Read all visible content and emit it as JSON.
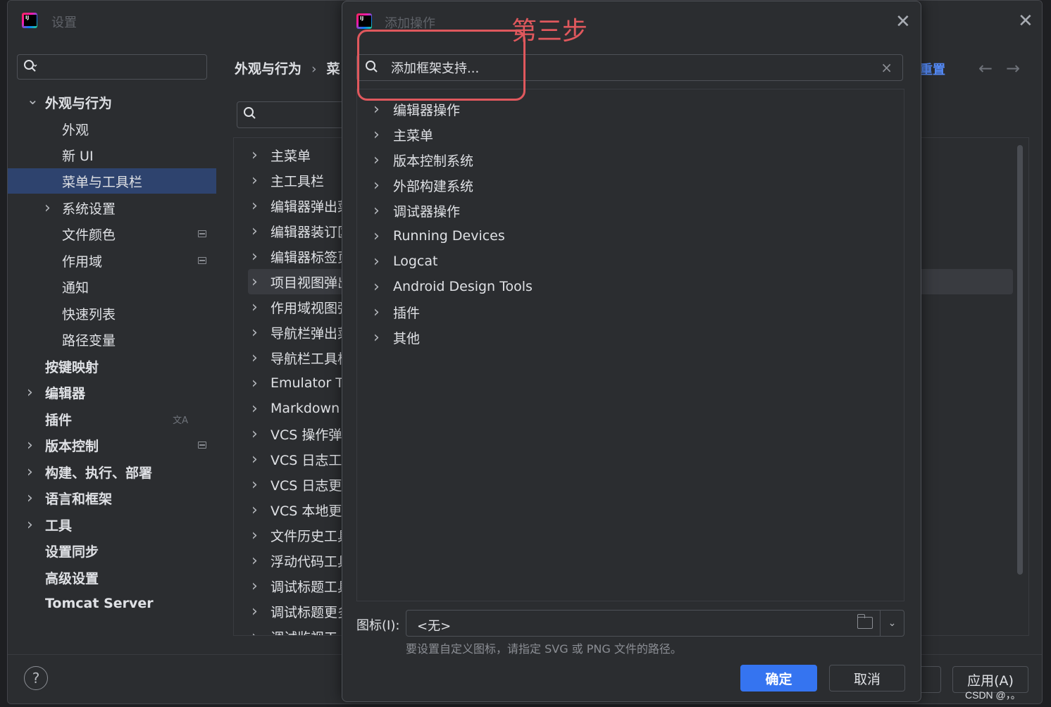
{
  "settings": {
    "title": "设置",
    "search_placeholder": "",
    "sidebar": [
      {
        "label": "外观与行为",
        "bold": true,
        "expanded": true
      },
      {
        "label": "外观"
      },
      {
        "label": "新 UI"
      },
      {
        "label": "菜单与工具栏",
        "selected": true
      },
      {
        "label": "系统设置",
        "collapsed": true
      },
      {
        "label": "文件颜色"
      },
      {
        "label": "作用域"
      },
      {
        "label": "通知"
      },
      {
        "label": "快速列表"
      },
      {
        "label": "路径变量"
      },
      {
        "label": "按键映射",
        "bold": true
      },
      {
        "label": "编辑器",
        "bold": true,
        "collapsed": true
      },
      {
        "label": "插件",
        "bold": true
      },
      {
        "label": "版本控制",
        "bold": true,
        "collapsed": true
      },
      {
        "label": "构建、执行、部署",
        "bold": true,
        "collapsed": true
      },
      {
        "label": "语言和框架",
        "bold": true,
        "collapsed": true
      },
      {
        "label": "工具",
        "bold": true,
        "collapsed": true
      },
      {
        "label": "设置同步",
        "bold": true
      },
      {
        "label": "高级设置",
        "bold": true
      },
      {
        "label": "Tomcat Server",
        "bold": true
      }
    ],
    "breadcrumb": [
      "外观与行为",
      "菜"
    ],
    "reset_link": "重置",
    "nav_back": "←",
    "nav_forward": "→",
    "menu_items": [
      "主菜单",
      "主工具栏",
      "编辑器弹出菜",
      "编辑器装订区",
      "编辑器标签页",
      "项目视图弹出",
      "作用域视图弹",
      "导航栏弹出菜",
      "导航栏工具栏",
      "Emulator To",
      "Markdown",
      "VCS 操作弹",
      "VCS 日志工",
      "VCS 日志更",
      "VCS 本地更",
      "文件历史工具",
      "浮动代码工具",
      "调试标题工具",
      "调试标题更多",
      "调试监视工"
    ],
    "selected_menu_index": 5,
    "footer": {
      "help": "?",
      "apply_label": "应用(A)"
    }
  },
  "dialog": {
    "title": "添加操作",
    "search_value": "添加框架支持...",
    "clear_icon": "×",
    "actions": [
      "编辑器操作",
      "主菜单",
      "版本控制系统",
      "外部构建系统",
      "调试器操作",
      "Running Devices",
      "Logcat",
      "Android Design Tools",
      "插件",
      "其他"
    ],
    "icon_label": "图标(I):",
    "icon_value": "<无>",
    "hint": "要设置自定义图标，请指定 SVG 或 PNG 文件的路径。",
    "ok_label": "确定",
    "cancel_label": "取消"
  },
  "annotation": {
    "text": "第三步",
    "color": "#e0585d"
  },
  "watermark": "CSDN @，。",
  "colors": {
    "background": "#2b2d30",
    "selection": "#2e436e",
    "primary_button": "#3574f0",
    "link": "#548af7"
  }
}
